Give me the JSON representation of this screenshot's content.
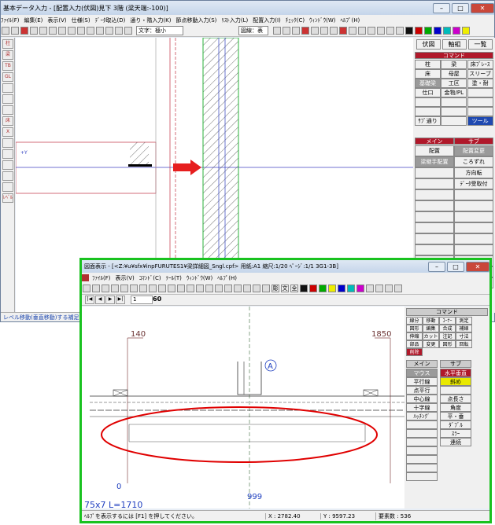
{
  "main": {
    "title": "基本データ入力 - [配置入力(伏図)見下 3階 (梁天端:-100)]",
    "menu": [
      "ﾌｧｲﾙ(F)",
      "編集(E)",
      "表示(V)",
      "仕様(S)",
      "ﾃﾞｰﾀ取込(D)",
      "通り・階入力(K)",
      "節点移動入力(S)",
      "ﾘｽﾄ入力(L)",
      "配置入力(I)",
      "ﾁｪｯｸ(C)",
      "ｳｨﾝﾄﾞｳ(W)",
      "ﾍﾙﾌﾟ(H)"
    ],
    "toolbar": {
      "font_select": "文字：極小",
      "layer_select": "図線：表"
    },
    "status": "レベル移動(垂直移動)する補足",
    "axis_label": "+Y",
    "panel": {
      "tabs": [
        "伏図",
        "軸組",
        "一覧"
      ],
      "command_header": "コマンド",
      "command_buttons": [
        "柱",
        "梁",
        "床ﾌﾞﾚｰｽ",
        "床",
        "母屋",
        "スリーブ",
        "基礎梁",
        "工区",
        "塗・耐",
        "仕口",
        "金物/PL",
        "",
        "",
        "",
        "",
        "",
        "",
        "",
        "ｻﾌﾞ通り",
        "",
        "ツール"
      ],
      "main_header": "メイン",
      "sub_header": "サブ",
      "main_items": [
        "配置",
        "梁継手配置",
        "",
        "",
        "",
        "",
        "",
        "",
        "",
        "",
        "",
        "",
        ""
      ],
      "sub_items": [
        "配置変更",
        "ころずれ",
        "方向転",
        "ﾃﾞｰﾀ受取付",
        "",
        "",
        "",
        "",
        "",
        "",
        "",
        "",
        ""
      ]
    },
    "left_icons": [
      "柱",
      "梁",
      "TB",
      "GL",
      "",
      "",
      "",
      "床",
      "X",
      "",
      "",
      "",
      "",
      "",
      "ﾚﾍﾞﾙ"
    ]
  },
  "sub": {
    "title": "図面表示 - [<Z:¥u¥sfx¥inpFURUTES1¥梁詳細図_Sngl.cpf> 用紙:A1 縮尺:1/20 ﾍﾟｰｼﾞ:1/1 3G1-3B]",
    "menu": [
      "ﾌｧｲﾙ(F)",
      "表示(V)",
      "ｺﾏﾝﾄﾞ(C)",
      "ﾃｰﾙ(T)",
      "ｳｨﾝﾄﾞｳ(W)",
      "ﾍﾙﾌﾟ(H)"
    ],
    "toolbar_labels": [
      "彫",
      "文",
      "全"
    ],
    "page_number": "1",
    "zoom": "60",
    "command_header": "コマンド",
    "command_grid": [
      "線分",
      "移動",
      "ｺｰﾅｰ",
      "測定",
      "図形",
      "編集",
      "合成",
      "補線",
      "伸縮",
      "カット",
      "注記",
      "寸法",
      "部品",
      "変更",
      "図形",
      "回転",
      "削除"
    ],
    "main_header": "メイン",
    "sub_header": "サブ",
    "main_items": [
      "マウス",
      "平行線",
      "点平行",
      "中心線",
      "十字線",
      "ﾊｯﾁﾝｸﾞ"
    ],
    "sub_items": [
      "水平垂直",
      "斜め",
      "",
      "点長さ",
      "角度",
      "平・垂",
      "ﾀﾞﾌﾞﾙ",
      "ｽﾗｰ",
      "連続"
    ],
    "drawing": {
      "dim_left": "140",
      "dim_right": "1850",
      "grid_mark": "A",
      "dim_zero": "0",
      "dim_bottom": "999",
      "member_label": "75x7 L=1710"
    },
    "status": {
      "help": "ﾍﾙﾌﾟを表示するには [F1] を押してください。",
      "x": "X : 2782.40",
      "y": "Y : 9597.23",
      "count": "要素数 : 536"
    }
  },
  "colors": {
    "accent_red": "#b0182a",
    "highlight_green": "#19c21f",
    "ellipse_red": "#e00000",
    "arrow_red": "#e61e1e"
  }
}
